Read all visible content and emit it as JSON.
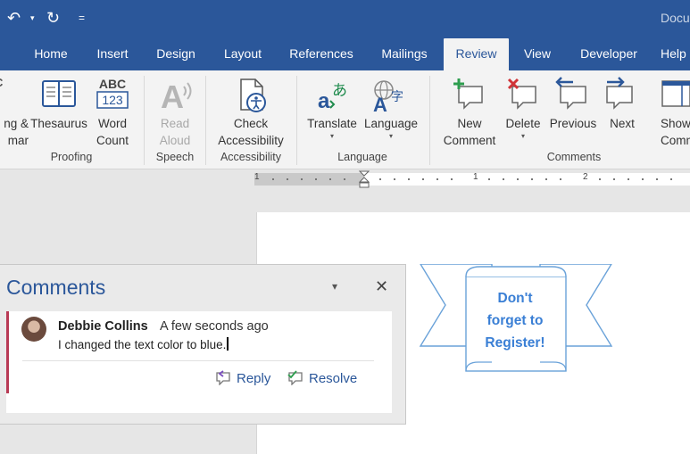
{
  "titlebar": {
    "undo_icon": "↶",
    "redo_icon": "↻",
    "dropdown_glyph": "▾",
    "customize_glyph": "=",
    "doc_title": "Docu"
  },
  "tabs": [
    "Home",
    "Insert",
    "Design",
    "Layout",
    "References",
    "Mailings",
    "Review",
    "View",
    "Developer",
    "Help"
  ],
  "active_tab": "Review",
  "ribbon": {
    "proofing": {
      "spelling": [
        "ng &",
        "mar"
      ],
      "thesaurus": "Thesaurus",
      "word_count": [
        "Word",
        "Count"
      ],
      "word_count_icon_top": "ABC",
      "word_count_icon_bottom": "123",
      "group_label": "Proofing"
    },
    "speech": {
      "read_aloud": [
        "Read",
        "Aloud"
      ],
      "group_label": "Speech"
    },
    "accessibility": {
      "check": [
        "Check",
        "Accessibility"
      ],
      "group_label": "Accessibility"
    },
    "language": {
      "translate": "Translate",
      "language": "Language",
      "group_label": "Language"
    },
    "comments": {
      "new_comment": [
        "New",
        "Comment"
      ],
      "delete": "Delete",
      "previous": "Previous",
      "next": "Next",
      "show_comments": [
        "Show",
        "Comme"
      ],
      "group_label": "Comments"
    }
  },
  "ruler": {
    "labels": [
      "1",
      "1",
      "2"
    ]
  },
  "banner": {
    "lines": [
      "Don't",
      "forget to",
      "Register!"
    ]
  },
  "comments_pane": {
    "title": "Comments",
    "menu_glyph": "▾",
    "close_glyph": "✕",
    "comment": {
      "author": "Debbie Collins",
      "time": "A few seconds ago",
      "text": "I changed the text color to blue."
    },
    "reply_label": "Reply",
    "resolve_label": "Resolve"
  },
  "colors": {
    "accent": "#2b579a",
    "banner_text": "#3a7fd5",
    "comment_accent": "#b83a55"
  }
}
